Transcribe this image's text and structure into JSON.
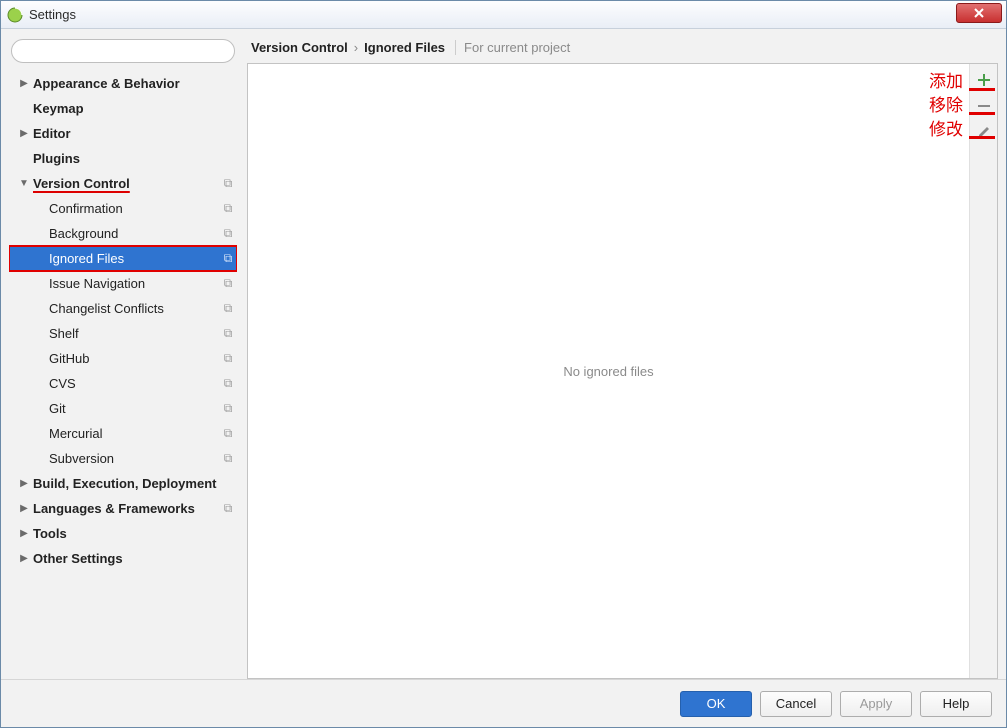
{
  "window": {
    "title": "Settings"
  },
  "search": {
    "placeholder": "",
    "value": ""
  },
  "tree": {
    "appearance": "Appearance & Behavior",
    "keymap": "Keymap",
    "editor": "Editor",
    "plugins": "Plugins",
    "version_control": "Version Control",
    "vc_children": {
      "confirmation": "Confirmation",
      "background": "Background",
      "ignored_files": "Ignored Files",
      "issue_navigation": "Issue Navigation",
      "changelist_conflicts": "Changelist Conflicts",
      "shelf": "Shelf",
      "github": "GitHub",
      "cvs": "CVS",
      "git": "Git",
      "mercurial": "Mercurial",
      "subversion": "Subversion"
    },
    "build": "Build, Execution, Deployment",
    "languages": "Languages & Frameworks",
    "tools": "Tools",
    "other": "Other Settings"
  },
  "breadcrumb": {
    "seg1": "Version Control",
    "seg2": "Ignored Files",
    "hint": "For current project"
  },
  "content": {
    "empty_text": "No ignored files"
  },
  "annotations": {
    "add": "添加",
    "remove": "移除",
    "edit": "修改"
  },
  "footer": {
    "ok": "OK",
    "cancel": "Cancel",
    "apply": "Apply",
    "help": "Help"
  }
}
